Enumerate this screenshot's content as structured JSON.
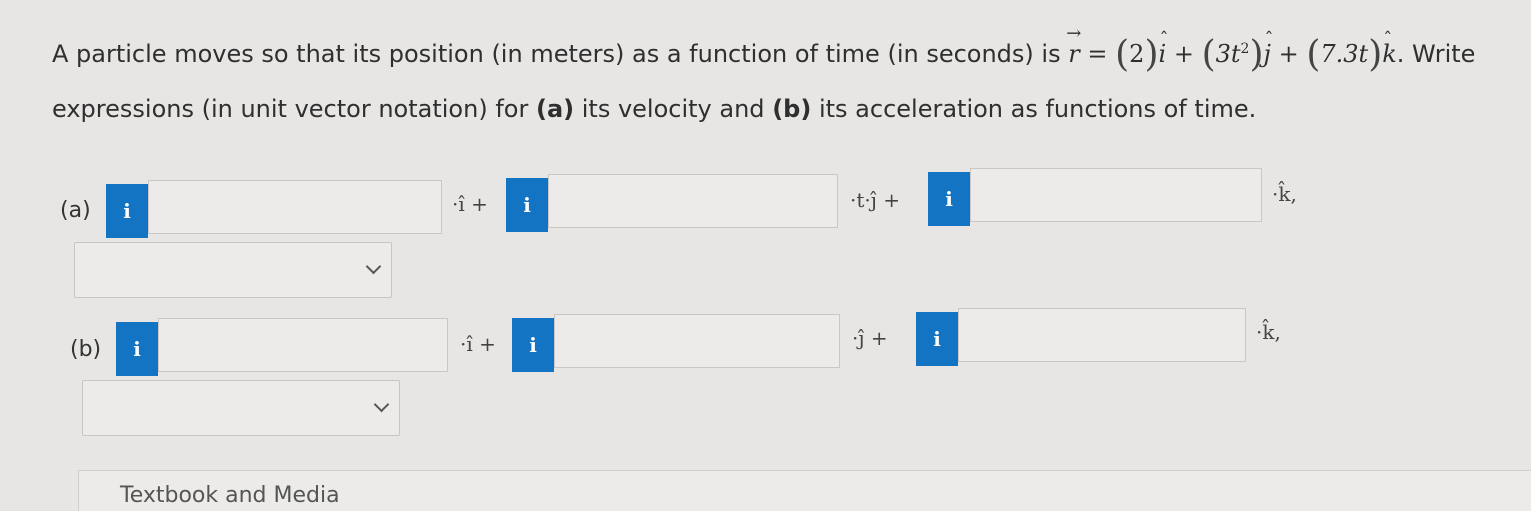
{
  "problem": {
    "text_before": "A particle moves so that its position (in meters) as a function of time (in seconds) is",
    "vector_symbol": "r",
    "equals": "=",
    "term1": "2",
    "term2": "3t",
    "term2_exp": "2",
    "term3": "7.3t",
    "i_hat": "i",
    "j_hat": "j",
    "k_hat": "k",
    "plus": "+",
    "text_after_1": ". Write",
    "text_after_2": "expressions (in unit vector notation) for",
    "part_a": "(a)",
    "part_a_text": "its velocity and",
    "part_b": "(b)",
    "part_b_text": "its acceleration as functions of time."
  },
  "rows": {
    "a": {
      "label": "(a)",
      "units": [
        "·î +",
        "·t·ĵ +",
        "·k̂,"
      ]
    },
    "b": {
      "label": "(b)",
      "units": [
        "·î +",
        "·ĵ +",
        "·k̂,"
      ]
    }
  },
  "info_icon": "i",
  "inputs": {
    "a1": "",
    "a2": "",
    "a3": "",
    "b1": "",
    "b2": "",
    "b3": ""
  },
  "selects": {
    "a_units": "",
    "b_units": ""
  },
  "bottom_text": "Textbook and Media"
}
